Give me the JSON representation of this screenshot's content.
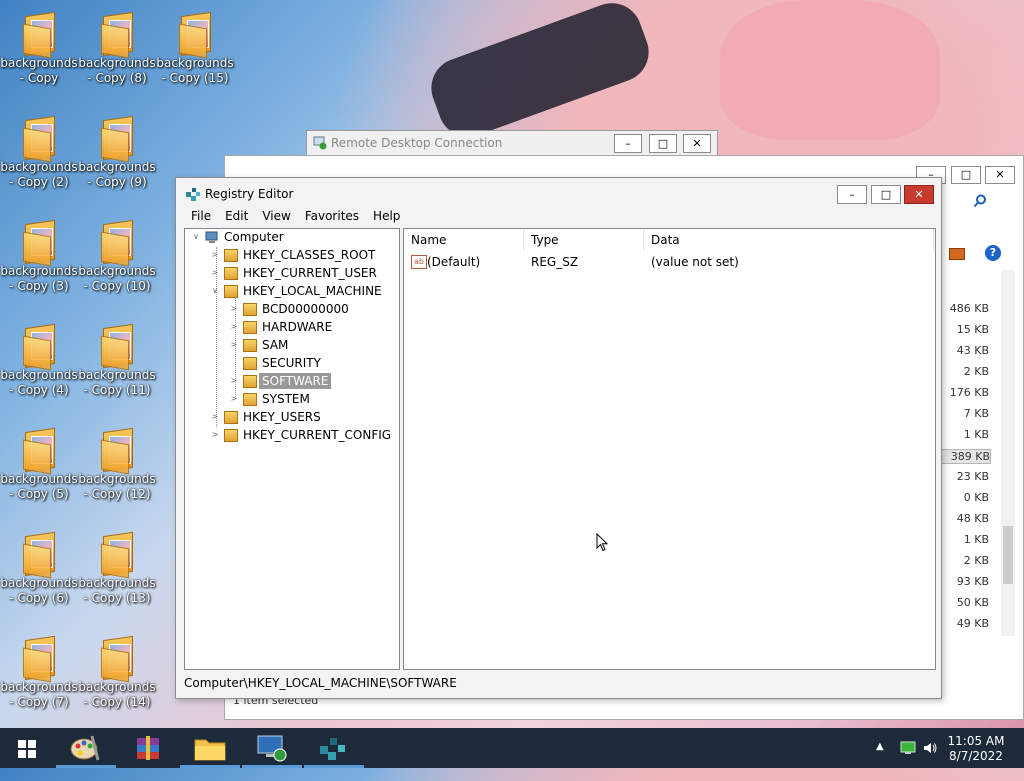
{
  "desktop": {
    "icons": [
      {
        "line1": "backgrounds",
        "line2": "- Copy"
      },
      {
        "line1": "backgrounds",
        "line2": "- Copy (2)"
      },
      {
        "line1": "backgrounds",
        "line2": "- Copy (3)"
      },
      {
        "line1": "backgrounds",
        "line2": "- Copy (4)"
      },
      {
        "line1": "backgrounds",
        "line2": "- Copy (5)"
      },
      {
        "line1": "backgrounds",
        "line2": "- Copy (6)"
      },
      {
        "line1": "backgrounds",
        "line2": "- Copy (7)"
      },
      {
        "line1": "backgrounds",
        "line2": "- Copy (8)"
      },
      {
        "line1": "backgrounds",
        "line2": "- Copy (9)"
      },
      {
        "line1": "backgrounds",
        "line2": "- Copy (10)"
      },
      {
        "line1": "backgrounds",
        "line2": "- Copy (11)"
      },
      {
        "line1": "backgrounds",
        "line2": "- Copy (12)"
      },
      {
        "line1": "backgrounds",
        "line2": "- Copy (13)"
      },
      {
        "line1": "backgrounds",
        "line2": "- Copy (14)"
      },
      {
        "line1": "backgrounds",
        "line2": "- Copy (15)"
      }
    ]
  },
  "rdc": {
    "title": "Remote Desktop Connection",
    "min": "–",
    "max": "□",
    "close": "✕"
  },
  "explorer": {
    "min": "–",
    "max": "□",
    "close": "✕",
    "search_icon": "search-icon",
    "sizes": [
      "486 KB",
      "15 KB",
      "43 KB",
      "2 KB",
      "176 KB",
      "7 KB",
      "1 KB",
      "389 KB",
      "23 KB",
      "0 KB",
      "48 KB",
      "1 KB",
      "2 KB",
      "93 KB",
      "50 KB",
      "49 KB"
    ],
    "status": "1 item selected",
    "help": "?"
  },
  "regedit": {
    "title": "Registry Editor",
    "min": "–",
    "max": "□",
    "close": "✕",
    "menu": [
      "File",
      "Edit",
      "View",
      "Favorites",
      "Help"
    ],
    "tree": {
      "root": "Computer",
      "hkcr": "HKEY_CLASSES_ROOT",
      "hkcu": "HKEY_CURRENT_USER",
      "hklm": "HKEY_LOCAL_MACHINE",
      "hklm_children": [
        "BCD00000000",
        "HARDWARE",
        "SAM",
        "SECURITY",
        "SOFTWARE",
        "SYSTEM"
      ],
      "hku": "HKEY_USERS",
      "hkcc": "HKEY_CURRENT_CONFIG"
    },
    "selected_key": "SOFTWARE",
    "columns": [
      "Name",
      "Type",
      "Data"
    ],
    "values": [
      {
        "name": "(Default)",
        "type": "REG_SZ",
        "data": "(value not set)"
      }
    ],
    "value_icon": "ab",
    "status_path": "Computer\\HKEY_LOCAL_MACHINE\\SOFTWARE"
  },
  "taskbar": {
    "apps": [
      "start",
      "paint",
      "winrar",
      "file-explorer",
      "remote-desktop",
      "registry-editor"
    ],
    "time": "11:05 AM",
    "date": "8/7/2022"
  },
  "colors": {
    "accent": "#5a9ad8",
    "taskbar": "#1d2a3a",
    "close_red": "#c63b2e",
    "selection": "#999999"
  }
}
